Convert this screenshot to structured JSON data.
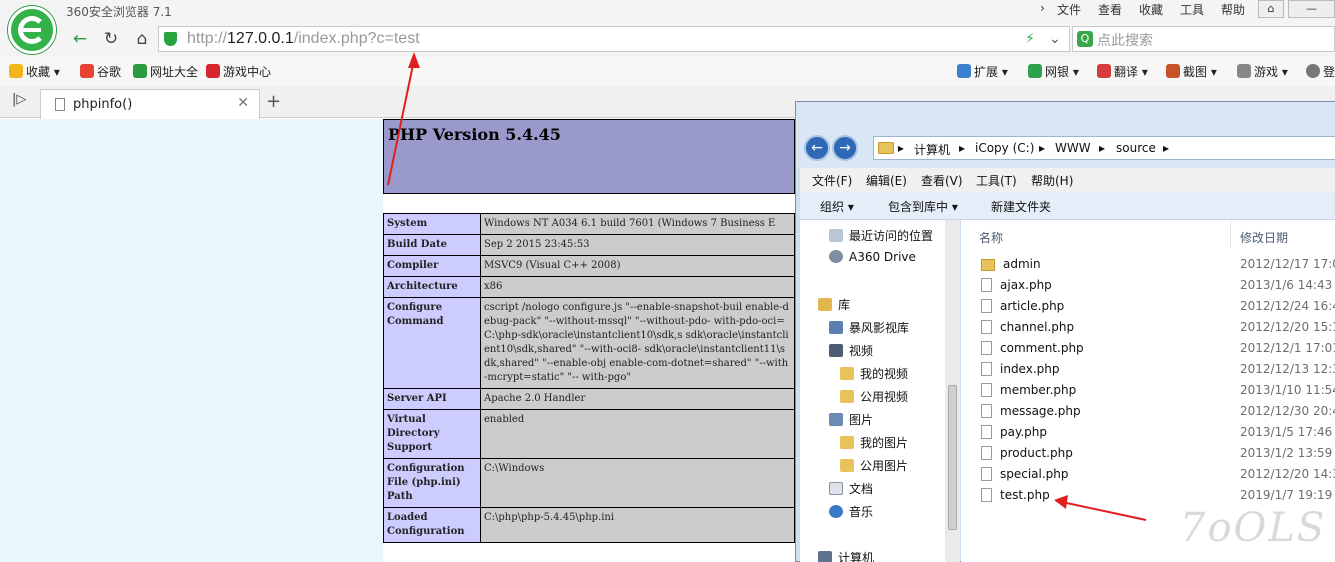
{
  "browser": {
    "app_title": "360安全浏览器 7.1",
    "top_menu": [
      "文件",
      "查看",
      "收藏",
      "工具",
      "帮助"
    ],
    "url": {
      "scheme": "http://",
      "host": "127.0.0.1",
      "path": "/index.php?c=test"
    },
    "search_placeholder": "点此搜索",
    "bookmarks": [
      "收藏",
      "谷歌",
      "网址大全",
      "游戏中心"
    ],
    "toolbar_right": [
      "扩展",
      "网银",
      "翻译",
      "截图",
      "游戏",
      "登"
    ],
    "tab_title": "phpinfo()",
    "colors": {
      "brand": "#34b24a",
      "arrow": "#e02020"
    }
  },
  "phpinfo": {
    "version": "PHP Version 5.4.45",
    "rows": [
      {
        "key": "System",
        "value": "Windows NT A034 6.1 build 7601 (Windows 7 Business E"
      },
      {
        "key": "Build Date",
        "value": "Sep 2 2015 23:45:53"
      },
      {
        "key": "Compiler",
        "value": "MSVC9 (Visual C++ 2008)"
      },
      {
        "key": "Architecture",
        "value": "x86"
      },
      {
        "key": "Configure Command",
        "value": "cscript /nologo configure.js \"--enable-snapshot-buil enable-debug-pack\" \"--without-mssql\" \"--without-pdo- with-pdo-oci=C:\\php-sdk\\oracle\\instantclient10\\sdk,s sdk\\oracle\\instantclient10\\sdk,shared\" \"--with-oci8- sdk\\oracle\\instantclient11\\sdk,shared\" \"--enable-obj enable-com-dotnet=shared\" \"--with-mcrypt=static\" \"-- with-pgo\""
      },
      {
        "key": "Server API",
        "value": "Apache 2.0 Handler"
      },
      {
        "key": "Virtual Directory Support",
        "value": "enabled"
      },
      {
        "key": "Configuration File (php.ini) Path",
        "value": "C:\\Windows"
      },
      {
        "key": "Loaded Configuration",
        "value": "C:\\php\\php-5.4.45\\php.ini"
      }
    ]
  },
  "explorer": {
    "breadcrumb": [
      "计算机",
      "iCopy (C:)",
      "WWW",
      "source"
    ],
    "menu": [
      "文件(F)",
      "编辑(E)",
      "查看(V)",
      "工具(T)",
      "帮助(H)"
    ],
    "toolbar": [
      "组织 ▾",
      "包含到库中 ▾",
      "新建文件夹"
    ],
    "nav": [
      "最近访问的位置",
      "A360 Drive",
      "库",
      "暴风影视库",
      "视频",
      "我的视频",
      "公用视频",
      "图片",
      "我的图片",
      "公用图片",
      "文档",
      "音乐",
      "计算机"
    ],
    "columns": {
      "name": "名称",
      "date": "修改日期"
    },
    "files": [
      {
        "name": "admin",
        "date": "2012/12/17 17:0",
        "folder": true
      },
      {
        "name": "ajax.php",
        "date": "2013/1/6 14:43"
      },
      {
        "name": "article.php",
        "date": "2012/12/24 16:4"
      },
      {
        "name": "channel.php",
        "date": "2012/12/20 15:1"
      },
      {
        "name": "comment.php",
        "date": "2012/12/1 17:01"
      },
      {
        "name": "index.php",
        "date": "2012/12/13 12:3"
      },
      {
        "name": "member.php",
        "date": "2013/1/10 11:54"
      },
      {
        "name": "message.php",
        "date": "2012/12/30 20:4"
      },
      {
        "name": "pay.php",
        "date": "2013/1/5 17:46"
      },
      {
        "name": "product.php",
        "date": "2013/1/2 13:59"
      },
      {
        "name": "special.php",
        "date": "2012/12/20 14:3"
      },
      {
        "name": "test.php",
        "date": "2019/1/7 19:19"
      }
    ]
  },
  "watermark": "7oOLS"
}
